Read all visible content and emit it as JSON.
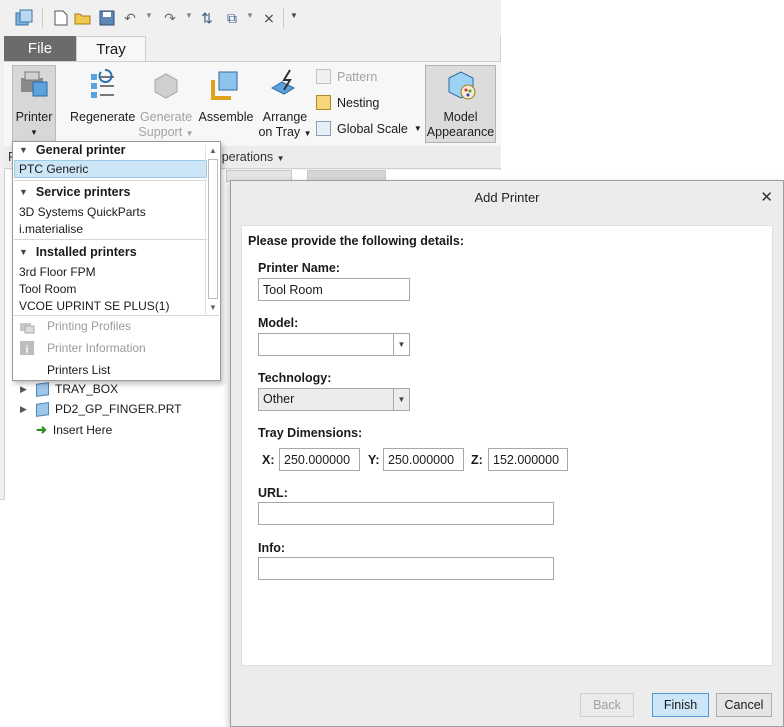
{
  "ribbon": {
    "tabs": [
      {
        "label": "File"
      },
      {
        "label": "Tray"
      }
    ],
    "buttons": {
      "printer": "Printer",
      "regenerate": "Regenerate",
      "generate_support_1": "Generate",
      "generate_support_2": "Support",
      "assemble": "Assemble",
      "arrange_1": "Arrange",
      "arrange_2": "on Tray",
      "pattern": "Pattern",
      "nesting": "Nesting",
      "global_scale": "Global Scale",
      "model_appearance_1": "Model",
      "model_appearance_2": "Appearance"
    },
    "group_label": "Operations",
    "panel_tab_partial": "R"
  },
  "printer_dropdown": {
    "general_header": "General printer",
    "general_items": [
      "PTC Generic"
    ],
    "service_header": "Service printers",
    "service_items": [
      "3D Systems QuickParts",
      "i.materialise"
    ],
    "installed_header": "Installed printers",
    "installed_items": [
      "3rd Floor FPM",
      "Tool Room",
      "VCOE UPRINT SE PLUS(1)"
    ],
    "actions": {
      "printing_profiles": "Printing Profiles",
      "printer_information": "Printer Information",
      "printers_list": "Printers List"
    }
  },
  "model_tree": {
    "items": [
      {
        "label": "TRAY_BOX"
      },
      {
        "label": "PD2_GP_FINGER.PRT"
      },
      {
        "label": "Insert Here"
      }
    ]
  },
  "dialog": {
    "title": "Add Printer",
    "instructions": "Please provide the following details:",
    "printer_name_label": "Printer Name:",
    "printer_name_value": "Tool Room",
    "model_label": "Model:",
    "model_value": "",
    "technology_label": "Technology:",
    "technology_value": "Other",
    "tray_dimensions_label": "Tray Dimensions:",
    "x_label": "X:",
    "x_value": "250.000000",
    "y_label": "Y:",
    "y_value": "250.000000",
    "z_label": "Z:",
    "z_value": "152.000000",
    "url_label": "URL:",
    "url_value": "",
    "info_label": "Info:",
    "info_value": "",
    "buttons": {
      "back": "Back",
      "finish": "Finish",
      "cancel": "Cancel"
    }
  },
  "colors": {
    "selected_highlight": "#cde6f7",
    "file_tab": "#6b6b6b",
    "finish_button": "#cce6f8",
    "insert_arrow": "#2e8b1f"
  }
}
